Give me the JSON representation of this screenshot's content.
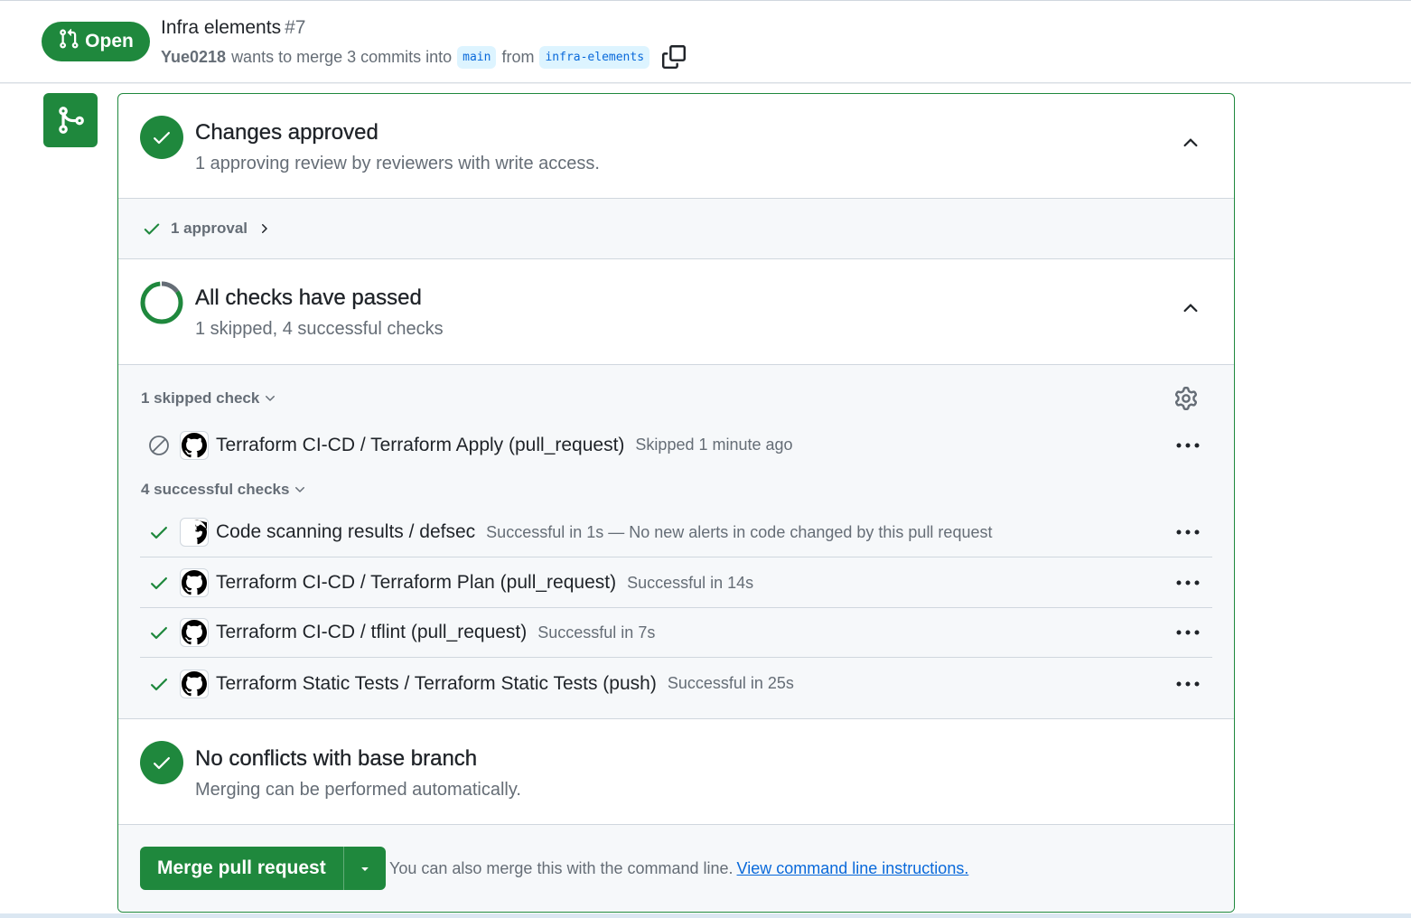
{
  "header": {
    "state_label": "Open",
    "title": "Infra elements",
    "number": "#7",
    "author": "Yue0218",
    "merge_text": "wants to merge 3 commits into",
    "base_branch": "main",
    "from_text": "from",
    "head_branch": "infra-elements"
  },
  "approved": {
    "heading": "Changes approved",
    "subtext": "1 approving review by reviewers with write access.",
    "approval_link": "1 approval"
  },
  "checks": {
    "heading": "All checks have passed",
    "subtext": "1 skipped, 4 successful checks",
    "skipped_group": "1 skipped check",
    "successful_group": "4 successful checks",
    "skipped": [
      {
        "name": "Terraform CI-CD / Terraform Apply (pull_request)",
        "desc": "Skipped 1 minute ago"
      }
    ],
    "successful": [
      {
        "name": "Code scanning results / defsec",
        "desc": "Successful in 1s — No new alerts in code changed by this pull request"
      },
      {
        "name": "Terraform CI-CD / Terraform Plan (pull_request)",
        "desc": "Successful in 14s"
      },
      {
        "name": "Terraform CI-CD / tflint (pull_request)",
        "desc": "Successful in 7s"
      },
      {
        "name": "Terraform Static Tests / Terraform Static Tests (push)",
        "desc": "Successful in 25s"
      }
    ]
  },
  "conflicts": {
    "heading": "No conflicts with base branch",
    "subtext": "Merging can be performed automatically."
  },
  "merge": {
    "button_label": "Merge pull request",
    "hint": "You can also merge this with the command line.",
    "link": "View command line instructions."
  },
  "colors": {
    "success": "#1f883d",
    "link": "#0969da",
    "muted": "#656d76"
  }
}
